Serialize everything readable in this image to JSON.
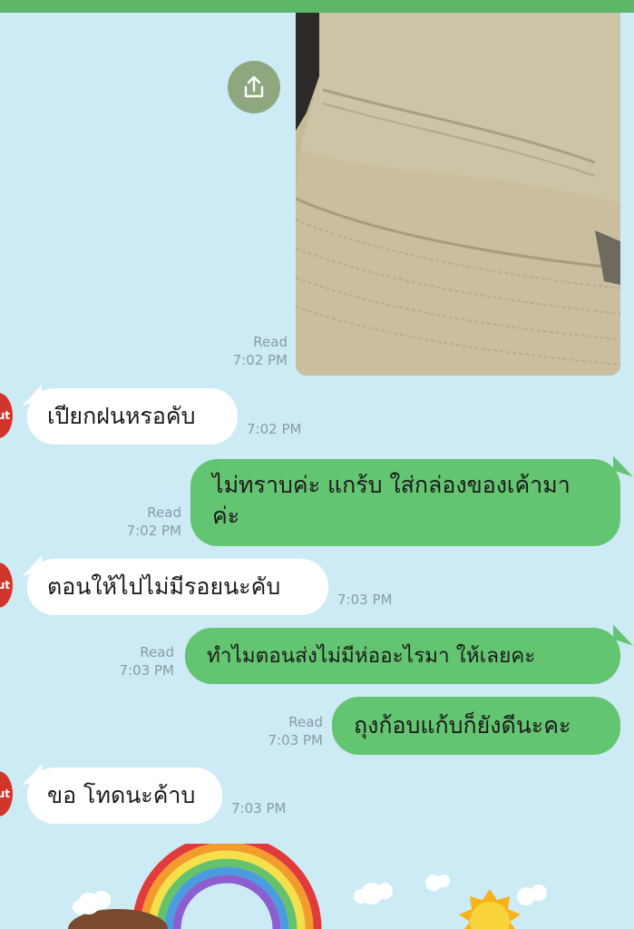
{
  "messages": [
    {
      "id": "m0",
      "side": "out",
      "type": "image",
      "status": "Read",
      "time": "7:02 PM"
    },
    {
      "id": "m1",
      "side": "in",
      "text": "เปียกฝนหรอคับ",
      "time": "7:02 PM",
      "avatar_text": "ut"
    },
    {
      "id": "m2",
      "side": "out",
      "text_line1": "ไม่ทราบค่ะ แกร้บ ใส่กล่องของเค้ามา",
      "text_line2": "ค่ะ",
      "status": "Read",
      "time": "7:02 PM"
    },
    {
      "id": "m3",
      "side": "in",
      "text": "ตอนให้ไปไม่มีรอยนะคับ",
      "time": "7:03 PM",
      "avatar_text": "ut"
    },
    {
      "id": "m4",
      "side": "out",
      "text": "ทำไมตอนส่งไม่มีห่ออะไรมา ให้เลยคะ",
      "status": "Read",
      "time": "7:03 PM"
    },
    {
      "id": "m5",
      "side": "out",
      "text": "ถุงก้อบแก้บก็ยังดีนะคะ",
      "status": "Read",
      "time": "7:03 PM"
    },
    {
      "id": "m6",
      "side": "in",
      "text": "ขอ โทดนะค้าบ",
      "time": "7:03 PM",
      "avatar_text": "ut"
    }
  ],
  "icons": {
    "share": "share-icon"
  },
  "colors": {
    "background": "#cdebf5",
    "outgoing": "#63c471",
    "incoming": "#ffffff",
    "topbar": "#5cb868",
    "share_button": "#8fa77e"
  }
}
